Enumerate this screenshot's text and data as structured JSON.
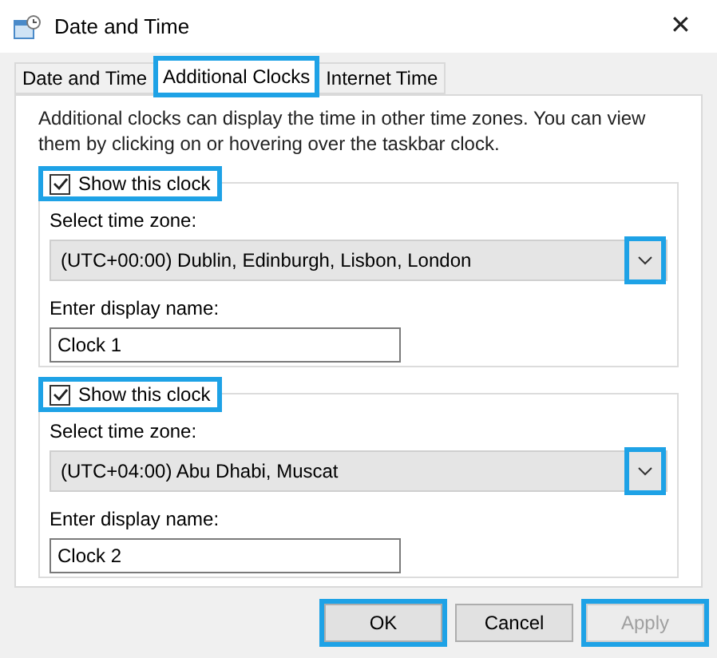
{
  "window": {
    "title": "Date and Time",
    "close": "✕"
  },
  "tabs": [
    {
      "label": "Date and Time",
      "selected": false,
      "highlighted": false
    },
    {
      "label": "Additional Clocks",
      "selected": true,
      "highlighted": true
    },
    {
      "label": "Internet Time",
      "selected": false,
      "highlighted": false
    }
  ],
  "description": "Additional clocks can display the time in other time zones. You can view them by clicking on or hovering over the taskbar clock.",
  "clocks": [
    {
      "show_label": "Show this clock",
      "checked": true,
      "highlighted": true,
      "zone_label": "Select time zone:",
      "zone": "(UTC+00:00) Dublin, Edinburgh, Lisbon, London",
      "dropdown_highlighted": true,
      "name_label": "Enter display name:",
      "name": "Clock 1"
    },
    {
      "show_label": "Show this clock",
      "checked": true,
      "highlighted": true,
      "zone_label": "Select time zone:",
      "zone": "(UTC+04:00) Abu Dhabi, Muscat",
      "dropdown_highlighted": true,
      "name_label": "Enter display name:",
      "name": "Clock 2"
    }
  ],
  "buttons": [
    {
      "label": "OK",
      "disabled": false,
      "highlighted": true
    },
    {
      "label": "Cancel",
      "disabled": false,
      "highlighted": false
    },
    {
      "label": "Apply",
      "disabled": true,
      "highlighted": true
    }
  ]
}
